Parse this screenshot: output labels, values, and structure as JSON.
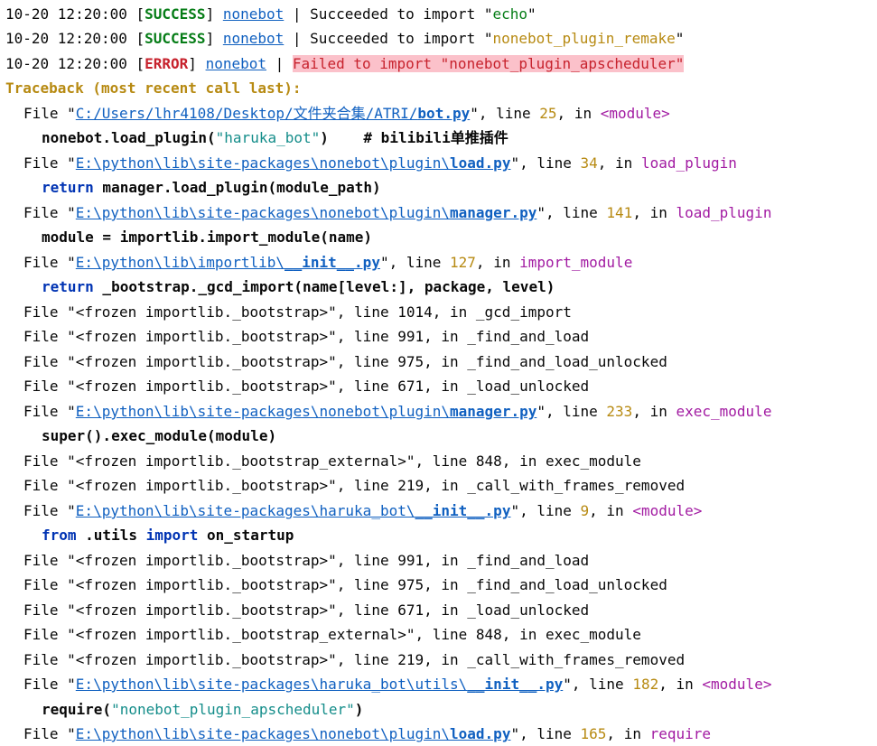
{
  "log_lines": [
    {
      "ts": "10-20 12:20:00",
      "level": "SUCCESS",
      "logger": "nonebot",
      "msg": "Succeeded to import \"",
      "mod": "echo",
      "end": "\""
    },
    {
      "ts": "10-20 12:20:00",
      "level": "SUCCESS",
      "logger": "nonebot",
      "msg": "Succeeded to import \"",
      "mod": "nonebot_plugin_remake",
      "end": "\""
    },
    {
      "ts": "10-20 12:20:00",
      "level": "ERROR",
      "logger": "nonebot",
      "msg": "Failed to import \"nonebot_plugin_apscheduler\""
    }
  ],
  "traceback_header": "Traceback (most recent call last):",
  "file_label": "File \"",
  "line_label": "\", line ",
  "in_label": ", in ",
  "frames": {
    "f1": {
      "dir": "C:/Users/lhr4108/Desktop/文件夹合集/ATRI/",
      "name": "bot.py",
      "line": "25",
      "func": "<module>"
    },
    "c1": {
      "pre": "nonebot.load_plugin(",
      "str": "\"haruka_bot\"",
      "post": ")    # bilibili单推插件"
    },
    "f2": {
      "dir": "E:\\python\\lib\\site-packages\\nonebot\\plugin\\",
      "name": "load.py",
      "line": "34",
      "func": "load_plugin"
    },
    "c2": {
      "kw": "return",
      "rest": " manager.load_plugin(module_path)"
    },
    "f3": {
      "dir": "E:\\python\\lib\\site-packages\\nonebot\\plugin\\",
      "name": "manager.py",
      "line": "141",
      "func": "load_plugin"
    },
    "c3": {
      "text": "module = importlib.import_module(name)"
    },
    "f4": {
      "dir": "E:\\python\\lib\\importlib\\",
      "name": "__init__.py",
      "line": "127",
      "func": "import_module"
    },
    "c4": {
      "kw": "return",
      "rest": " _bootstrap._gcd_import(name[level:], package, level)"
    },
    "fz1": "File \"<frozen importlib._bootstrap>\", line 1014, in _gcd_import",
    "fz2": "File \"<frozen importlib._bootstrap>\", line 991, in _find_and_load",
    "fz3": "File \"<frozen importlib._bootstrap>\", line 975, in _find_and_load_unlocked",
    "fz4": "File \"<frozen importlib._bootstrap>\", line 671, in _load_unlocked",
    "f5": {
      "dir": "E:\\python\\lib\\site-packages\\nonebot\\plugin\\",
      "name": "manager.py",
      "line": "233",
      "func": "exec_module"
    },
    "c5": {
      "text": "super().exec_module(module)"
    },
    "fz5": "File \"<frozen importlib._bootstrap_external>\", line 848, in exec_module",
    "fz6": "File \"<frozen importlib._bootstrap>\", line 219, in _call_with_frames_removed",
    "f6": {
      "dir": "E:\\python\\lib\\site-packages\\haruka_bot\\",
      "name": "__init__.py",
      "line": "9",
      "func": "<module>"
    },
    "c6": {
      "kw1": "from",
      "mid": " .utils ",
      "kw2": "import",
      "rest": " on_startup"
    },
    "fz7": "File \"<frozen importlib._bootstrap>\", line 991, in _find_and_load",
    "fz8": "File \"<frozen importlib._bootstrap>\", line 975, in _find_and_load_unlocked",
    "fz9": "File \"<frozen importlib._bootstrap>\", line 671, in _load_unlocked",
    "fz10": "File \"<frozen importlib._bootstrap_external>\", line 848, in exec_module",
    "fz11": "File \"<frozen importlib._bootstrap>\", line 219, in _call_with_frames_removed",
    "f7": {
      "dir": "E:\\python\\lib\\site-packages\\haruka_bot\\utils\\",
      "name": "__init__.py",
      "line": "182",
      "func": "<module>"
    },
    "c7": {
      "pre": "require(",
      "str": "\"nonebot_plugin_apscheduler\"",
      "post": ")"
    },
    "f8": {
      "dir": "E:\\python\\lib\\site-packages\\nonebot\\plugin\\",
      "name": "load.py",
      "line": "165",
      "func": "require"
    }
  }
}
